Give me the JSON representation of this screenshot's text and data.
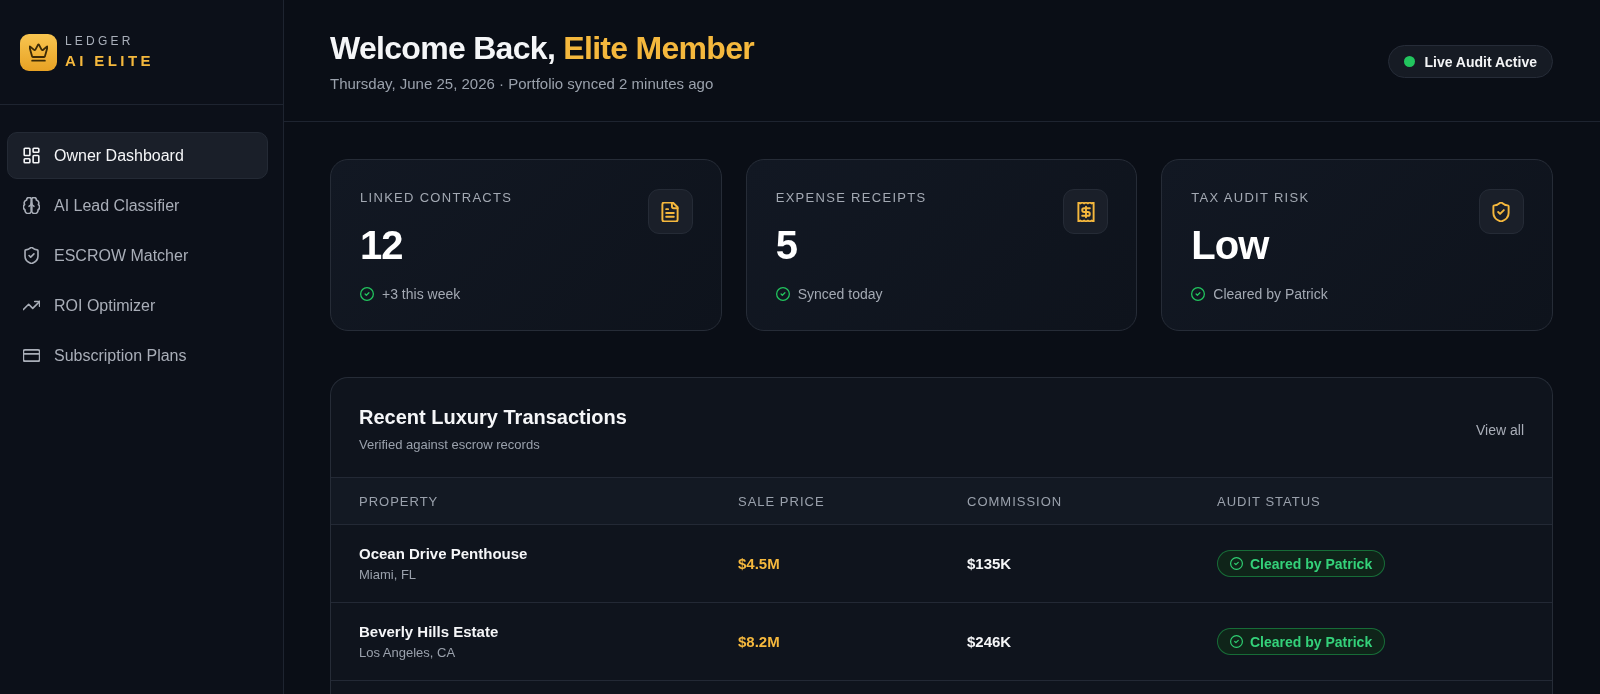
{
  "sidebar": {
    "brand": {
      "label": "LEDGER",
      "name": "AI ELITE"
    },
    "nav_items": [
      {
        "label": "Owner Dashboard",
        "selected": true
      },
      {
        "label": "AI Lead Classifier",
        "selected": false
      },
      {
        "label": "ESCROW Matcher",
        "selected": false
      },
      {
        "label": "ROI Optimizer",
        "selected": false
      },
      {
        "label": "Subscription Plans",
        "selected": false
      }
    ]
  },
  "header": {
    "greeting": "Welcome Back,",
    "member": "Elite Member",
    "subtitle": "Thursday, June 25, 2026 · Portfolio synced 2 minutes ago",
    "live_status": "Live Audit Active"
  },
  "stat_cards": [
    {
      "label": "LINKED CONTRACTS",
      "value": "12",
      "note": "+3 this week"
    },
    {
      "label": "EXPENSE RECEIPTS",
      "value": "5",
      "note": "Synced today"
    },
    {
      "label": "TAX AUDIT RISK",
      "value": "Low",
      "note": "Cleared by Patrick"
    }
  ],
  "transactions": {
    "title": "Recent Luxury Transactions",
    "subtitle": "Verified against escrow records",
    "link": "View all",
    "columns": [
      "PROPERTY",
      "SALE PRICE",
      "COMMISSION",
      "AUDIT STATUS"
    ],
    "rows": [
      {
        "property": "Ocean Drive Penthouse",
        "location": "Miami, FL",
        "sale_price": "$4.5M",
        "commission": "$135K",
        "audit_status": "Cleared by Patrick"
      },
      {
        "property": "Beverly Hills Estate",
        "location": "Los Angeles, CA",
        "sale_price": "$8.2M",
        "commission": "$246K",
        "audit_status": "Cleared by Patrick"
      }
    ]
  }
}
